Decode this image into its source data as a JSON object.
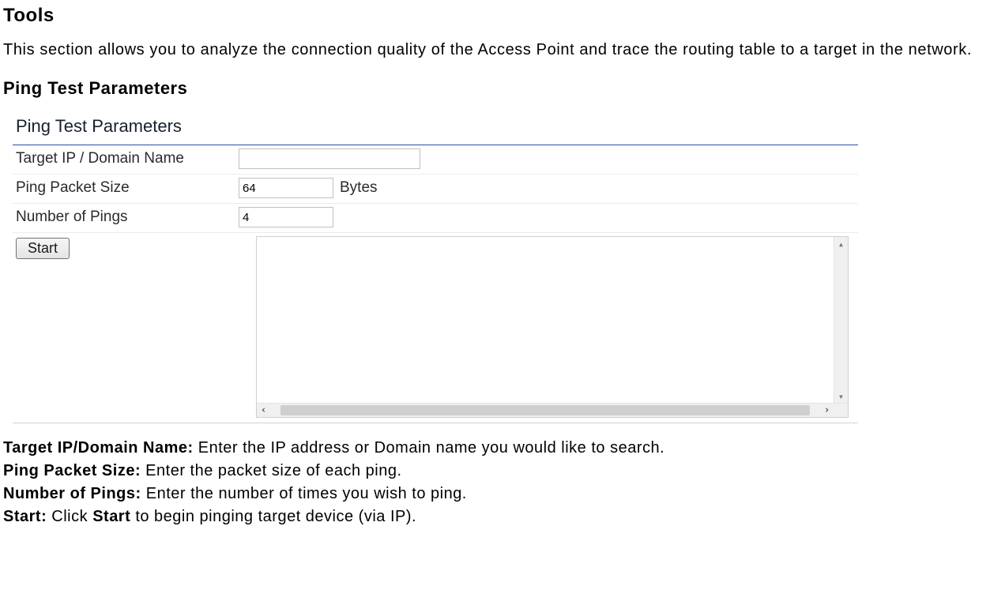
{
  "page": {
    "title": "Tools",
    "intro": "This section allows you to analyze the connection quality of the Access Point and trace the routing table to a target in the network.",
    "section_heading": "Ping Test Parameters"
  },
  "panel": {
    "title": "Ping Test Parameters",
    "rows": {
      "target": {
        "label": "Target IP / Domain Name",
        "value": ""
      },
      "size": {
        "label": "Ping Packet Size",
        "value": "64",
        "unit": "Bytes"
      },
      "count": {
        "label": "Number of Pings",
        "value": "4"
      }
    },
    "start_label": "Start",
    "results_text": ""
  },
  "desc": {
    "target": {
      "term": "Target IP/Domain Name:",
      "text": " Enter the IP address or Domain name you would like to search."
    },
    "size": {
      "term": "Ping Packet Size:",
      "text": " Enter the packet size of each ping."
    },
    "count": {
      "term": "Number of Pings:",
      "text": " Enter the number of times you wish to ping."
    },
    "start": {
      "term": "Start:",
      "pre": " Click ",
      "bold": "Start",
      "post": " to begin pinging target device (via IP)."
    }
  }
}
